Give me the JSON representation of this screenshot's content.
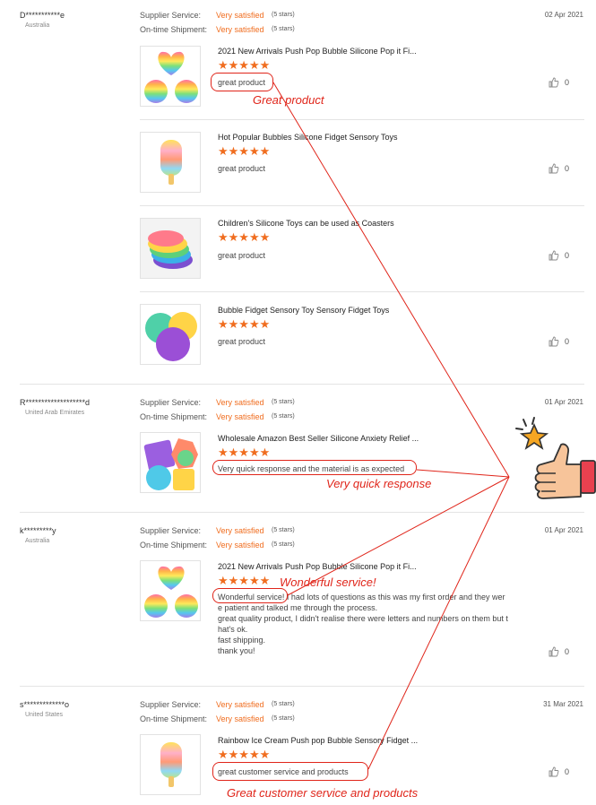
{
  "labels": {
    "supplier_service": "Supplier Service:",
    "ontime_shipment": "On-time Shipment:",
    "very_satisfied": "Very satisfied",
    "five_stars": "(5 stars)",
    "stars_glyph": "★★★★★"
  },
  "reviews": [
    {
      "name": "D***********e",
      "country": "Australia",
      "date": "02 Apr 2021",
      "items": [
        {
          "title": "2021 New Arrivals Push Pop Bubble Silicone Pop it Fi...",
          "text": "great product",
          "likes": "0"
        },
        {
          "title": "Hot Popular Bubbles Silicone Fidget Sensory Toys",
          "text": "great product",
          "likes": "0"
        },
        {
          "title": "Children's Silicone Toys can be used as Coasters",
          "text": "great product",
          "likes": "0"
        },
        {
          "title": "Bubble Fidget Sensory Toy Sensory Fidget Toys",
          "text": "great product",
          "likes": "0"
        }
      ]
    },
    {
      "name": "R*******************d",
      "country": "United Arab Emirates",
      "date": "01 Apr 2021",
      "items": [
        {
          "title": "Wholesale Amazon Best Seller Silicone Anxiety Relief ...",
          "text": "Very quick response and the material is as expected",
          "likes": ""
        }
      ]
    },
    {
      "name": "k*********y",
      "country": "Australia",
      "date": "01 Apr 2021",
      "items": [
        {
          "title": "2021 New Arrivals Push Pop Bubble Silicone Pop it Fi...",
          "text": "Wonderful service! I had lots of questions as this was my first order and they were patient and talked me through the process.\ngreat quality product, I didn't realise there were letters and numbers on them but that's ok.\nfast shipping.\nthank you!",
          "text_display": "Wonderful service! I had lots of questions as this was my first order and they wer\ne patient and talked me through the process.\ngreat quality product, I didn't realise there were letters and numbers on them but t\nhat's ok.\nfast shipping.\nthank you!",
          "likes": "0"
        }
      ]
    },
    {
      "name": "s*************o",
      "country": "United States",
      "date": "31 Mar 2021",
      "items": [
        {
          "title": "Rainbow Ice Cream Push pop Bubble Sensory Fidget ...",
          "text": "great customer service and products",
          "likes": "0"
        }
      ]
    }
  ],
  "callouts": {
    "great_product": "Great product",
    "quick_response": "Very quick response",
    "wonderful_service": "Wonderful service!",
    "customer_service": "Great customer service and products"
  },
  "colors": {
    "accent_orange": "#f06d1f",
    "annotation_red": "#e0251a",
    "separator": "#e4e4e4"
  },
  "icons": [
    "thumbs-up-icon",
    "star-icon",
    "thumbs-up-sticker-icon"
  ]
}
